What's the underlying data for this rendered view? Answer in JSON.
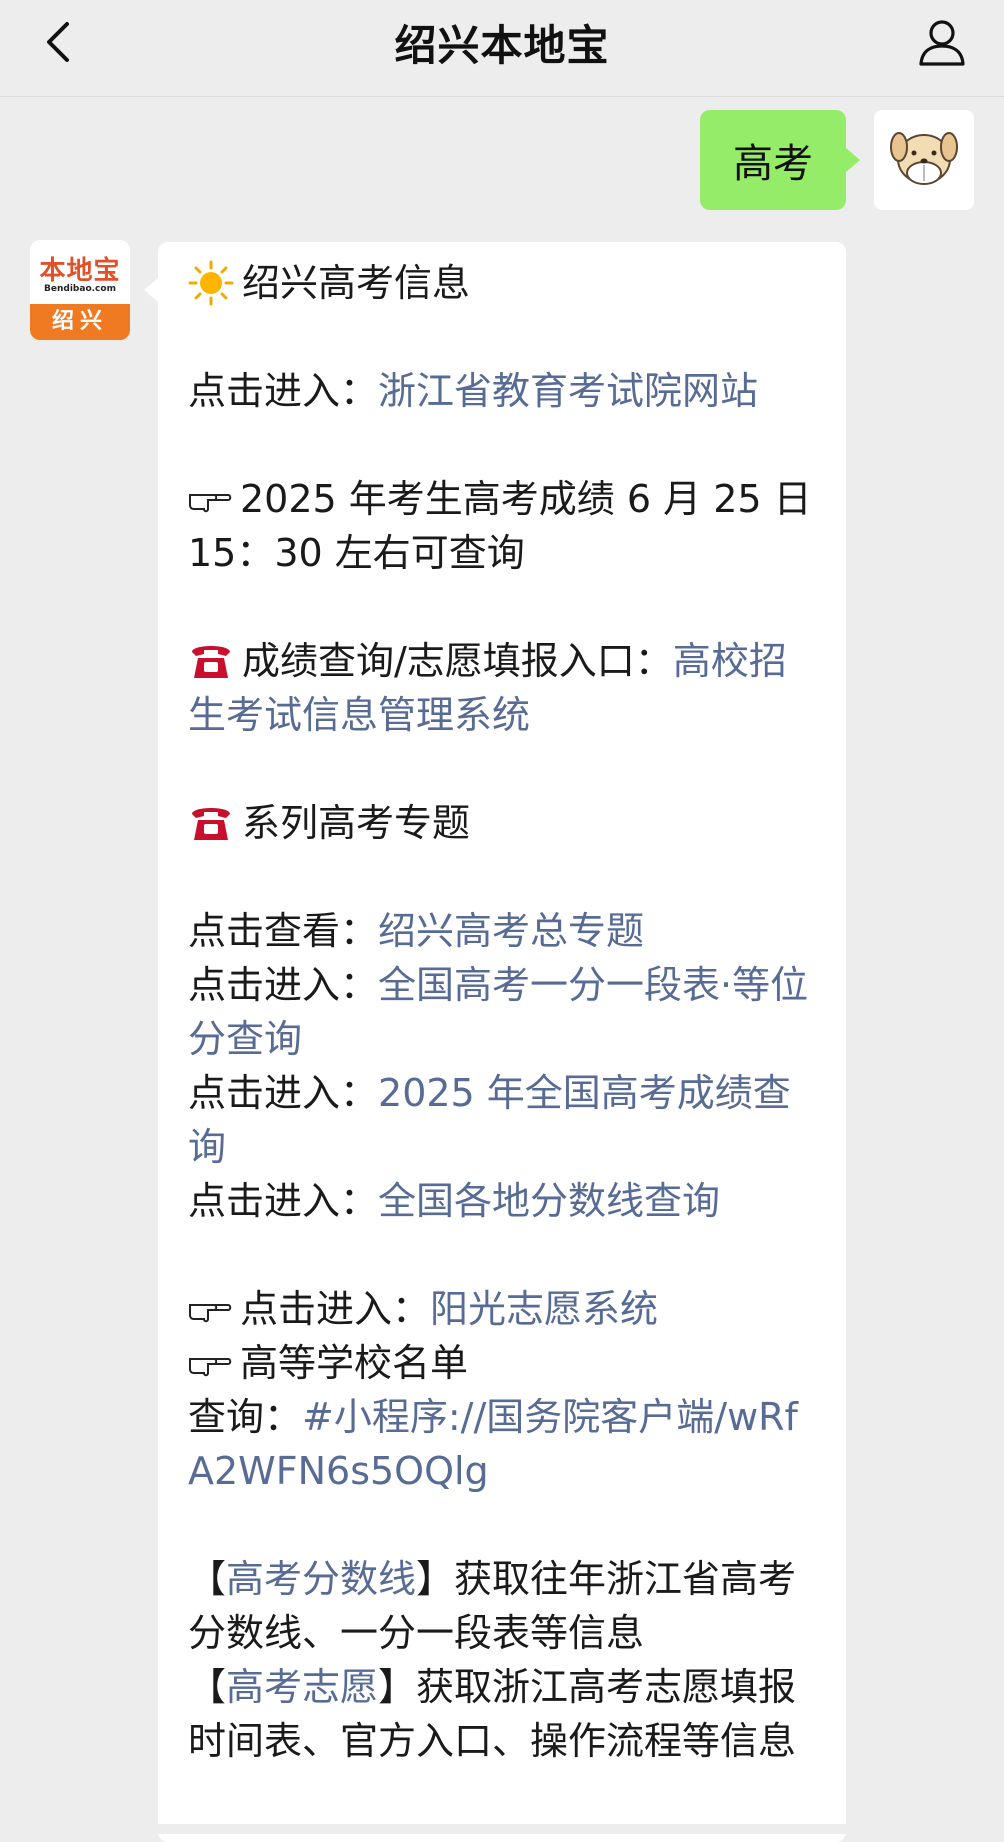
{
  "header": {
    "title": "绍兴本地宝"
  },
  "sent_message": {
    "text": "高考"
  },
  "bot_avatar": {
    "logo_text": "本地宝",
    "domain": "Bendibao.com",
    "city": "绍兴"
  },
  "reply": {
    "heading": "绍兴高考信息",
    "line_edu": {
      "prefix": "点击进入：",
      "link": "浙江省教育考试院网站"
    },
    "score_notice": "2025 年考生高考成绩 6 月 25 日 15：30 左右可查询",
    "entry": {
      "prefix": "成绩查询/志愿填报入口：",
      "link": "高校招生考试信息管理系统"
    },
    "series_title": "系列高考专题",
    "topics": [
      {
        "prefix": "点击查看：",
        "link": "绍兴高考总专题"
      },
      {
        "prefix": "点击进入：",
        "link": "全国高考一分一段表·等位分查询"
      },
      {
        "prefix": "点击进入：",
        "link": "2025 年全国高考成绩查询"
      },
      {
        "prefix": "点击进入：",
        "link": "全国各地分数线查询"
      }
    ],
    "sunshine": {
      "prefix": "点击进入：",
      "link": "阳光志愿系统"
    },
    "schools_title": "高等学校名单",
    "query": {
      "prefix": "查询：",
      "link": "#小程序://国务院客户端/wRfA2WFN6s5OQlg"
    },
    "keywords": [
      {
        "open": "【",
        "link": "高考分数线",
        "close": "】",
        "text": "获取往年浙江省高考分数线、一分一段表等信息"
      },
      {
        "open": "【",
        "link": "高考志愿",
        "close": "】",
        "text": "获取浙江高考志愿填报时间表、官方入口、操作流程等信息"
      }
    ]
  },
  "colors": {
    "background": "#ededed",
    "sent_bubble": "#95ec69",
    "link": "#576b95",
    "brand_orange": "#f07a22"
  },
  "icons": [
    "back-chevron",
    "person-outline",
    "sun",
    "pointing-hand",
    "telephone"
  ]
}
